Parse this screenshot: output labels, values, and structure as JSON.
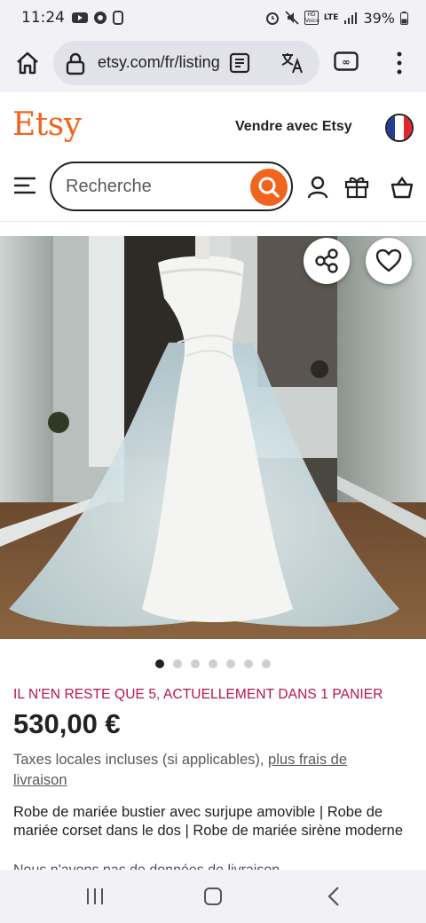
{
  "status_bar": {
    "time": "11:24",
    "network": "LTE",
    "hd_label": "HD Voice",
    "battery": "39%"
  },
  "browser": {
    "url": "etsy.com/fr/listing",
    "icons": [
      "home-icon",
      "lock-icon",
      "reader-mode-icon",
      "translate-icon",
      "tab-switcher-icon",
      "more-vert-icon"
    ]
  },
  "header": {
    "logo": "Etsy",
    "sell_link": "Vendre avec Etsy",
    "search_placeholder": "Recherche",
    "icons": [
      "menu-icon",
      "search-icon",
      "account-icon",
      "gift-icon",
      "cart-icon"
    ],
    "flag_colors": [
      "#1f3d99",
      "#ffffff",
      "#e3262e"
    ]
  },
  "gallery": {
    "image_count": 7,
    "active_index": 0
  },
  "product": {
    "stock_notice": "IL N'EN RESTE QUE 5, ACTUELLEMENT DANS 1 PANIER",
    "price": "530,00 €",
    "tax_text": "Taxes locales incluses (si applicables), ",
    "shipping_link": "plus frais de livraison",
    "title": "Robe de mariée bustier avec surjupe amovible | Robe de mariée corset dans le dos | Robe de mariée sirène moderne",
    "cut_text": "Nous n'avons pas de données de livraison"
  },
  "colors": {
    "accent": "#f1641e",
    "stock_notice": "#b8144a"
  }
}
